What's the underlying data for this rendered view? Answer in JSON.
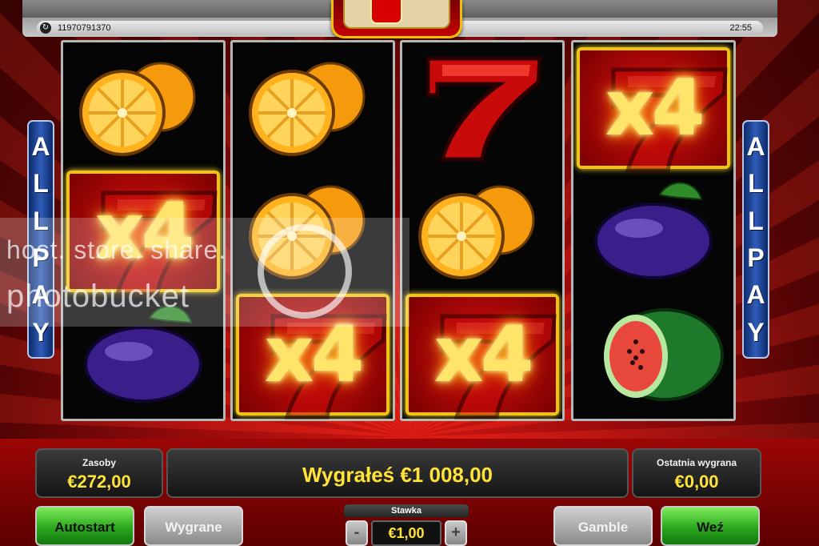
{
  "header": {
    "session_id": "11970791370",
    "clock": "22:55"
  },
  "side_banner": {
    "left_letters": [
      "A",
      "L",
      "L",
      "P",
      "A",
      "Y"
    ],
    "right_letters": [
      "A",
      "L",
      "L",
      "P",
      "A",
      "Y"
    ]
  },
  "reels": [
    {
      "symbols": [
        "orange",
        "x4-seven",
        "plum"
      ]
    },
    {
      "symbols": [
        "orange",
        "orange",
        "x4-seven"
      ]
    },
    {
      "symbols": [
        "seven",
        "orange",
        "x4-seven"
      ]
    },
    {
      "symbols": [
        "x4-seven",
        "plum",
        "watermelon"
      ]
    }
  ],
  "multiplier_label": "x4",
  "watermark": {
    "line1": "host. store. share.",
    "line2": "photobucket"
  },
  "panels": {
    "balance_label": "Zasoby",
    "balance_value": "€272,00",
    "win_message": "Wygrałeś €1 008,00",
    "last_win_label": "Ostatnia wygrana",
    "last_win_value": "€0,00"
  },
  "controls": {
    "autostart": "Autostart",
    "wygrane": "Wygrane",
    "gamble": "Gamble",
    "take": "Weź",
    "stake_label": "Stawka",
    "stake_value": "€1,00",
    "minus": "-",
    "plus": "+"
  },
  "colors": {
    "background": "#c00d0d",
    "highlight_border": "#f0c40c",
    "value_text": "#ffe23a",
    "allpay_blue": "#1e4597",
    "green_button": "#2aa81e"
  }
}
